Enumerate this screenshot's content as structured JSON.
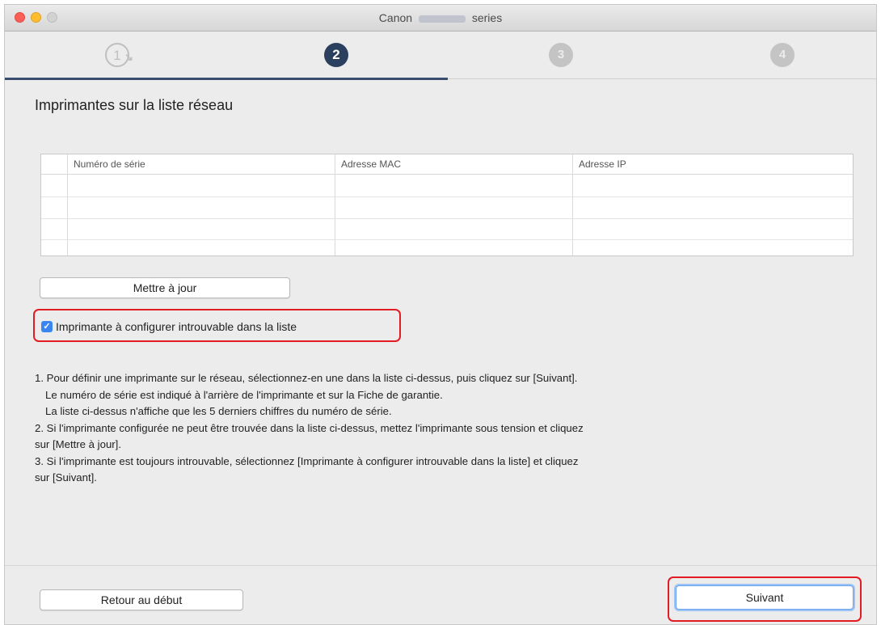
{
  "window": {
    "title_prefix": "Canon",
    "title_suffix": "series"
  },
  "steps": [
    {
      "label": "1",
      "state": "done"
    },
    {
      "label": "2",
      "state": "current"
    },
    {
      "label": "3",
      "state": "pending"
    },
    {
      "label": "4",
      "state": "pending"
    }
  ],
  "page": {
    "heading": "Imprimantes sur la liste réseau"
  },
  "table": {
    "columns": [
      "Numéro de série",
      "Adresse MAC",
      "Adresse IP"
    ],
    "rows": []
  },
  "update_button": "Mettre à jour",
  "checkbox": {
    "label": "Imprimante à configurer introuvable dans la liste",
    "checked": true
  },
  "instructions": [
    "1. Pour définir une imprimante sur le réseau, sélectionnez-en une dans la liste ci-dessus, puis cliquez sur [Suivant].",
    "Le numéro de série est indiqué à l'arrière de l'imprimante et sur la Fiche de garantie.",
    "La liste ci-dessus n'affiche que les 5 derniers chiffres du numéro de série.",
    "2. Si l'imprimante configurée ne peut être trouvée dans la liste ci-dessus, mettez l'imprimante sous tension et cliquez",
    "sur [Mettre à jour].",
    "3. Si l'imprimante est toujours introuvable, sélectionnez [Imprimante à configurer introuvable dans la liste] et cliquez",
    "sur [Suivant]."
  ],
  "footer": {
    "back_button": "Retour au début",
    "next_button": "Suivant"
  },
  "colors": {
    "highlight": "#e31b23",
    "step_active": "#2b3f5e",
    "checkbox": "#3a86f0"
  }
}
